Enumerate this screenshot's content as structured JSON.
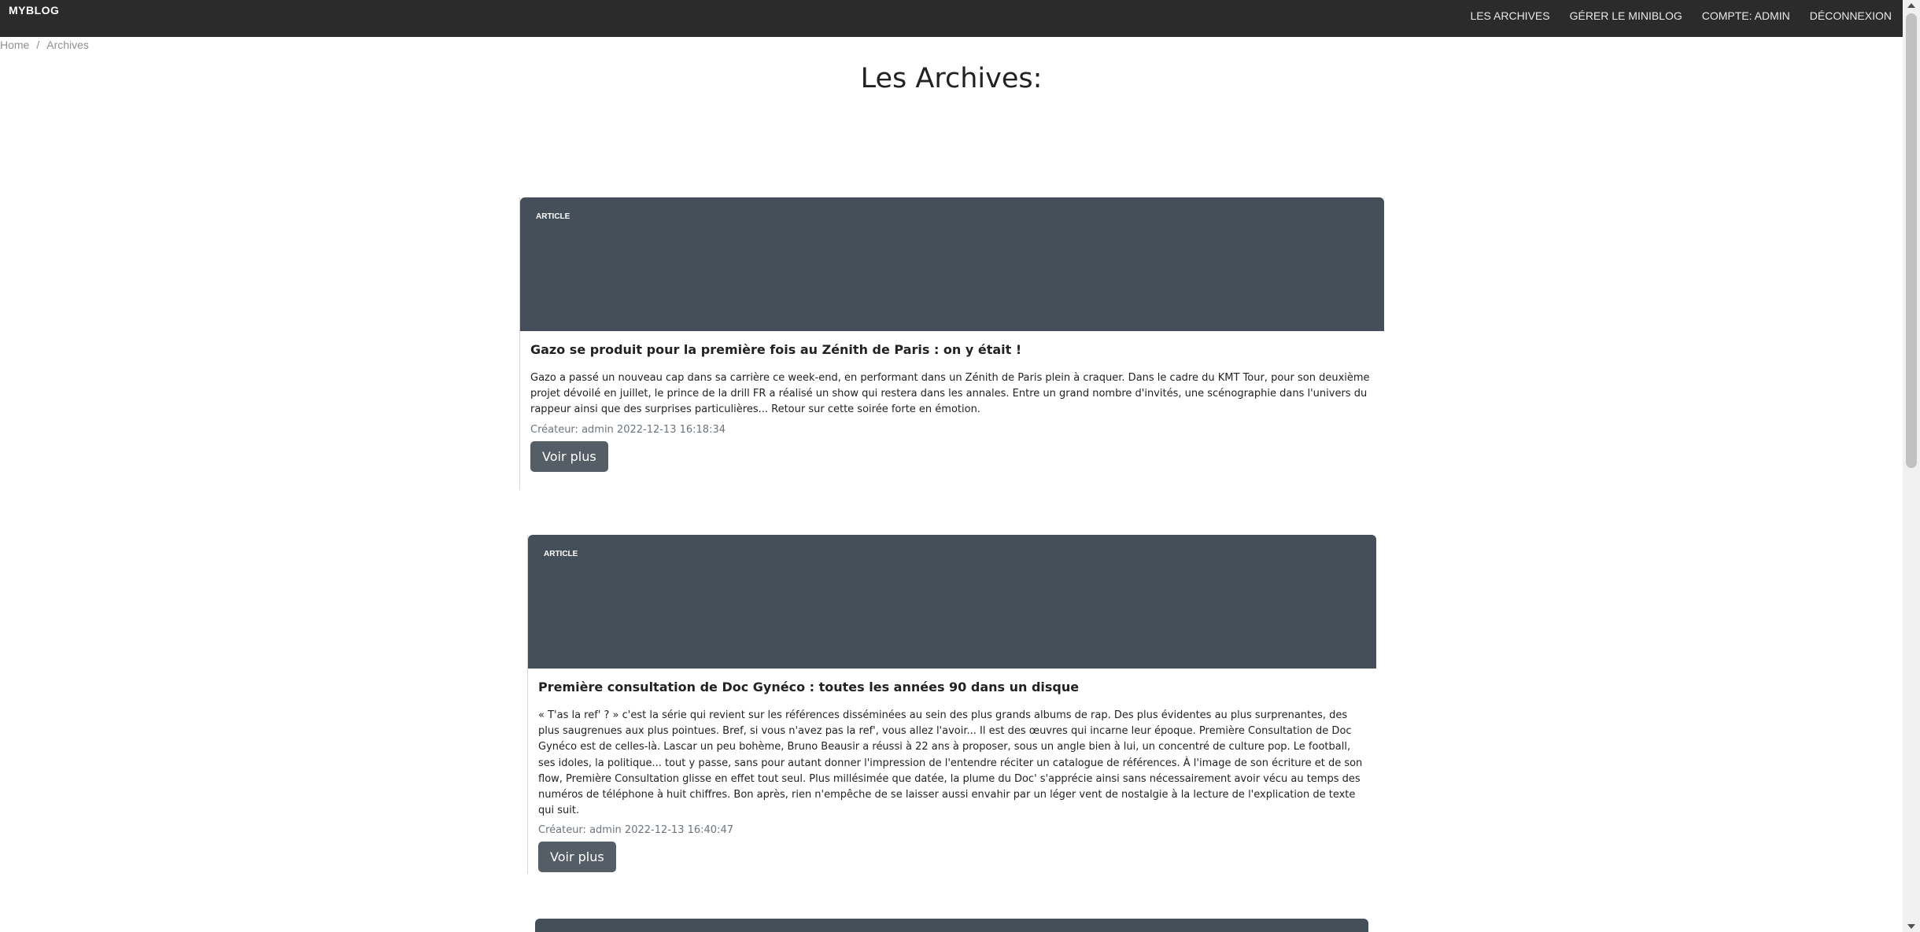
{
  "nav": {
    "brand": "MYBLOG",
    "links": [
      "LES ARCHIVES",
      "GÉRER LE MINIBLOG",
      "COMPTE: ADMIN",
      "DÉCONNEXION"
    ]
  },
  "breadcrumb": {
    "home": "Home",
    "separator": "/",
    "current": "Archives"
  },
  "page": {
    "title": "Les Archives:"
  },
  "articles": [
    {
      "badge": "ARTICLE",
      "title": "Gazo se produit pour la première fois au Zénith de Paris : on y était !",
      "excerpt": "Gazo a passé un nouveau cap dans sa carrière ce week-end, en performant dans un Zénith de Paris plein à craquer. Dans le cadre du KMT Tour, pour son deuxième projet dévoilé en juillet, le prince de la drill FR a réalisé un show qui restera dans les annales. Entre un grand nombre d'invités, une scénographie dans l'univers du rappeur ainsi que des surprises particulières... Retour sur cette soirée forte en émotion.",
      "meta": "Créateur: admin 2022-12-13 16:18:34",
      "button": "Voir plus"
    },
    {
      "badge": "ARTICLE",
      "title": "Première consultation de Doc Gynéco : toutes les années 90 dans un disque",
      "excerpt": "« T'as la ref' ? » c'est la série qui revient sur les références disséminées au sein des plus grands albums de rap. Des plus évidentes au plus surprenantes, des plus saugrenues aux plus pointues. Bref, si vous n'avez pas la ref', vous allez l'avoir... Il est des œuvres qui incarne leur époque. Première Consultation de Doc Gynéco est de celles-là. Lascar un peu bohème, Bruno Beausir a réussi à 22 ans à proposer, sous un angle bien à lui, un concentré de culture pop. Le football, ses idoles, la politique... tout y passe, sans pour autant donner l'impression de l'entendre réciter un catalogue de références. À l'image de son écriture et de son flow, Première Consultation glisse en effet tout seul. Plus millésimée que datée, la plume du Doc' s'apprécie ainsi sans nécessairement avoir vécu au temps des numéros de téléphone à huit chiffres. Bon après, rien n'empêche de se laisser aussi envahir par un léger vent de nostalgie à la lecture de l'explication de texte qui suit.",
      "meta": "Créateur: admin 2022-12-13 16:40:47",
      "button": "Voir plus"
    },
    {
      "badge": "",
      "title": "",
      "excerpt": "",
      "meta": "",
      "button": ""
    }
  ],
  "colors": {
    "navbar": "#2b2b2b",
    "card_header": "#454f59",
    "button": "#555e66"
  }
}
